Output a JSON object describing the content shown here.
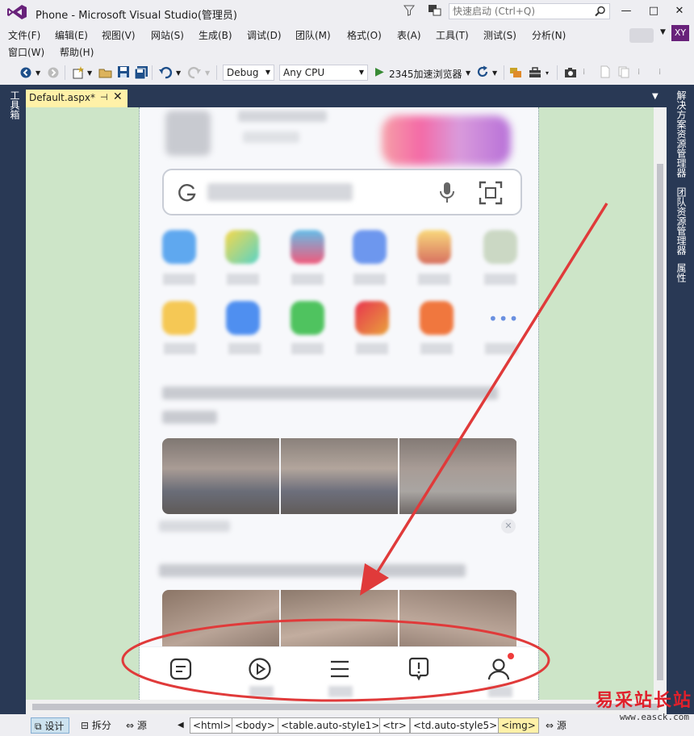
{
  "window": {
    "title": "Phone - Microsoft Visual Studio(管理员)",
    "quick_launch_placeholder": "快速启动 (Ctrl+Q)",
    "minimize": "—",
    "maximize": "□",
    "close": "✕",
    "user_initials": "XY"
  },
  "menu": {
    "row1": [
      "文件(F)",
      "编辑(E)",
      "视图(V)",
      "网站(S)",
      "生成(B)",
      "调试(D)",
      "团队(M)",
      "格式(O)",
      "表(A)",
      "工具(T)",
      "测试(S)",
      "分析(N)"
    ],
    "row2": [
      "窗口(W)",
      "帮助(H)"
    ]
  },
  "toolbar": {
    "config": "Debug",
    "platform": "Any CPU",
    "run_label": "2345加速浏览器"
  },
  "left_panel": {
    "toolbox": "工具箱"
  },
  "right_panel": {
    "solution_explorer": "解决方案资源管理器",
    "team_explorer": "团队资源管理器",
    "properties": "属性"
  },
  "document": {
    "tab_title": "Default.aspx*",
    "pin": "⊣",
    "close": "✕"
  },
  "statusbar": {
    "views": [
      "设计",
      "拆分",
      "源"
    ],
    "breadcrumbs": [
      "<html>",
      "<body>",
      "<table.auto-style1>",
      "<tr>",
      "<td.auto-style5>",
      "<img>"
    ],
    "source_button": "源"
  },
  "watermark": {
    "text": "易采站长站",
    "url": "www.easck.com"
  },
  "colors": {
    "vs_purple": "#68217a",
    "frame_navy": "#293955",
    "design_green": "#cde5c8",
    "tab_yellow": "#fff1a8",
    "annotation_red": "#e03a3a"
  },
  "phone_icons": {
    "bottom_nav": [
      "feed-icon",
      "video-play-icon",
      "menu-icon",
      "notice-icon",
      "profile-icon"
    ],
    "search": [
      "google-g-icon",
      "microphone-icon",
      "scan-icon"
    ]
  }
}
